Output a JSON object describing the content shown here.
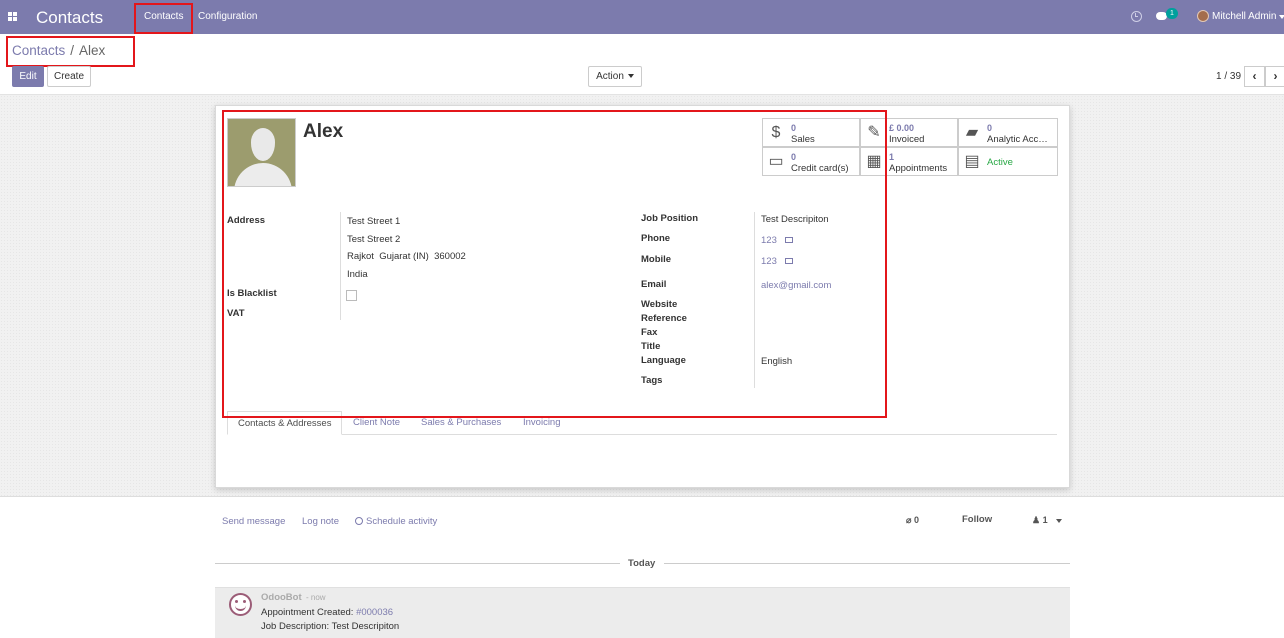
{
  "navbar": {
    "brand": "Contacts",
    "menu": [
      "Contacts",
      "Configuration"
    ],
    "chat_count": "1",
    "user_name": "Mitchell Admin"
  },
  "breadcrumb": {
    "parent": "Contacts",
    "separator": "/",
    "current": "Alex"
  },
  "buttons": {
    "edit": "Edit",
    "create": "Create",
    "action": "Action"
  },
  "pager": {
    "value": "1 / 39"
  },
  "partner": {
    "name": "Alex",
    "address_label": "Address",
    "street": "Test Street 1",
    "street2": "Test Street 2",
    "city_line": "Rajkot  Gujarat (IN)  360002",
    "country": "India",
    "blacklist_label": "Is Blacklist",
    "vat_label": "VAT",
    "job_label": "Job Position",
    "job_value": "Test Descripiton",
    "phone_label": "Phone",
    "phone_value": "123",
    "mobile_label": "Mobile",
    "mobile_value": "123",
    "email_label": "Email",
    "email_value": "alex@gmail.com",
    "website_label": "Website",
    "reference_label": "Reference",
    "fax_label": "Fax",
    "title_label": "Title",
    "language_label": "Language",
    "language_value": "English",
    "tags_label": "Tags"
  },
  "smart_buttons": [
    {
      "value": "0",
      "label": "Sales",
      "icon": "dollar-icon"
    },
    {
      "value": "£ 0.00",
      "label": "Invoiced",
      "icon": "pencil-square-icon"
    },
    {
      "value": "0",
      "label": "Analytic Acc…",
      "icon": "book-icon"
    },
    {
      "value": "0",
      "label": "Credit card(s)",
      "icon": "credit-card-icon"
    },
    {
      "value": "1",
      "label": "Appointments",
      "icon": "calendar-icon"
    },
    {
      "value": "",
      "label": "Active",
      "icon": "archive-icon"
    }
  ],
  "tabs": [
    "Contacts & Addresses",
    "Client Note",
    "Sales & Purchases",
    "Invoicing"
  ],
  "chatter": {
    "send_message": "Send message",
    "log_note": "Log note",
    "schedule": "Schedule activity",
    "attachments": "0",
    "follow": "Follow",
    "followers": "1",
    "today": "Today",
    "author": "OdooBot",
    "date": "- now",
    "line1_prefix": "Appointment Created: ",
    "line1_ref": "#000036",
    "line2": "Job Description: Test Descripiton"
  },
  "colors": {
    "navbar": "#7c7bad",
    "highlight": "#e3161b",
    "active_status": "#28a745"
  }
}
